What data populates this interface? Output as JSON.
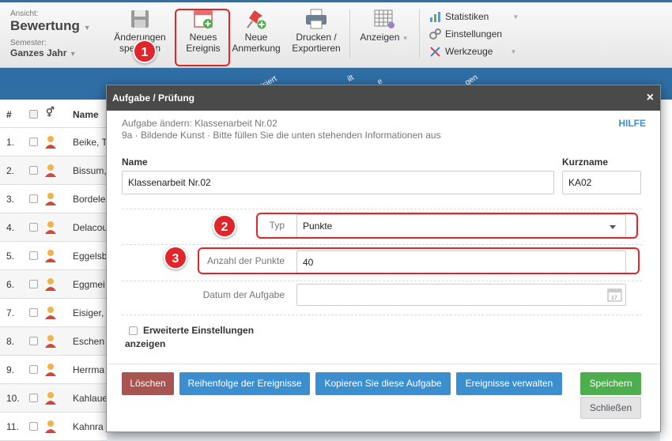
{
  "view": {
    "ansicht_label": "Ansicht:",
    "ansicht_value": "Bewertung",
    "semester_label": "Semester:",
    "semester_value": "Ganzes Jahr"
  },
  "toolbar": {
    "save_changes": [
      "Änderungen",
      "speichern"
    ],
    "new_event": [
      "Neues",
      "Ereignis"
    ],
    "new_note": [
      "Neue",
      "Anmerkung"
    ],
    "print_export": [
      "Drucken /",
      "Exportieren"
    ],
    "show": "Anzeigen",
    "list": [
      "Statistiken",
      "Einstellungen",
      "Werkzeuge"
    ]
  },
  "annotations": [
    "1",
    "2",
    "3"
  ],
  "header_band": [
    "visiert",
    "ilt",
    "e",
    "gen"
  ],
  "grid": {
    "col_hash": "#",
    "col_name": "Name",
    "rows": [
      {
        "num": "1.",
        "name": "Beike, T"
      },
      {
        "num": "2.",
        "name": "Bissum,"
      },
      {
        "num": "3.",
        "name": "Bordele"
      },
      {
        "num": "4.",
        "name": "Delacou"
      },
      {
        "num": "5.",
        "name": "Eggelsb"
      },
      {
        "num": "6.",
        "name": "Eggmei"
      },
      {
        "num": "7.",
        "name": "Eisiger,"
      },
      {
        "num": "8.",
        "name": "Eschen"
      },
      {
        "num": "9.",
        "name": "Herrma"
      },
      {
        "num": "10.",
        "name": "Kahlaue"
      },
      {
        "num": "11.",
        "name": "Kahnra"
      }
    ]
  },
  "modal": {
    "title": "Aufgabe / Prüfung",
    "close": "×",
    "subtitle1": "Aufgabe ändern: Klassenarbeit Nr.02",
    "subtitle2": "9a · Bildende Kunst · Bitte füllen Sie die unten stehenden Informationen aus",
    "help": "HILFE",
    "name_label": "Name",
    "name_value": "Klassenarbeit Nr.02",
    "short_label": "Kurzname",
    "short_value": "KA02",
    "type_label": "Typ",
    "type_value": "Punkte",
    "points_label": "Anzahl der Punkte",
    "points_value": "40",
    "date_label": "Datum der Aufgabe",
    "date_value": "",
    "advanced_label": "Erweiterte Einstellungen",
    "advanced_label2": "anzeigen",
    "buttons": {
      "delete": "Löschen",
      "order": "Reihenfolge der Ereignisse",
      "copy": "Kopieren Sie diese Aufgabe",
      "manage": "Ereignisse verwalten",
      "save": "Speichern",
      "close": "Schließen"
    }
  },
  "colors": {
    "accent_red": "#e0262a",
    "button_blue": "#3b8fcf",
    "button_green": "#4cae4c",
    "button_delete": "#a85450",
    "modal_header": "#4a4a4a",
    "help_link": "#3a8fd6"
  }
}
